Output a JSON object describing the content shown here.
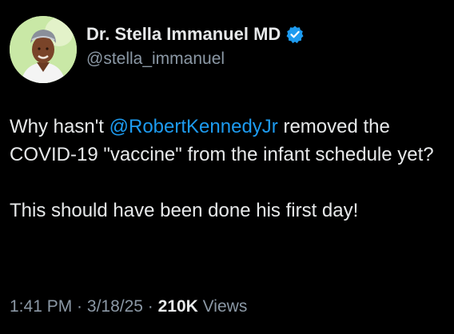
{
  "author": {
    "display_name": "Dr. Stella Immanuel MD",
    "handle": "@stella_immanuel",
    "avatar_icon": "profile-photo",
    "verified_icon": "verified-badge-icon",
    "verified_color": "#1d9bf0"
  },
  "tweet": {
    "line1_prefix": "Why hasn't ",
    "mention": "@RobertKennedyJr",
    "line1_suffix": " removed the COVID-19 \"vaccine\" from the infant schedule yet?",
    "paragraph2": "This should have been done his first day!"
  },
  "meta": {
    "time": "1:41 PM",
    "separator1": " · ",
    "date": "3/18/25",
    "separator2": " · ",
    "views_count": "210K",
    "views_label": " Views"
  },
  "colors": {
    "background": "#000000",
    "text": "#e7e9ea",
    "secondary": "#8b98a5",
    "link": "#1d9bf0"
  }
}
